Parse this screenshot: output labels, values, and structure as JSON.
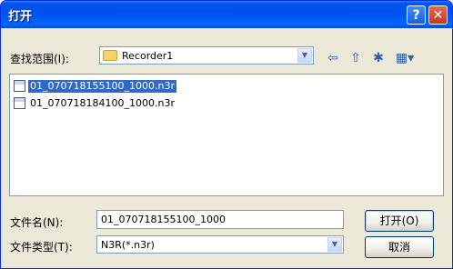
{
  "window": {
    "title": "打开"
  },
  "titlebar": {
    "help": "?",
    "close": "✕"
  },
  "lookin": {
    "label": "查找范围(I):",
    "value": "Recorder1"
  },
  "files": [
    {
      "name": "01_070718155100_1000.n3r",
      "selected": true
    },
    {
      "name": "01_070718184100_1000.n3r",
      "selected": false
    }
  ],
  "filename": {
    "label": "文件名(N):",
    "value": "01_070718155100_1000"
  },
  "filetype": {
    "label": "文件类型(T):",
    "value": "N3R(*.n3r)"
  },
  "buttons": {
    "open": "打开(O)",
    "cancel": "取消"
  },
  "icons": [
    "back-arrow-icon",
    "up-folder-icon",
    "new-folder-icon",
    "view-menu-icon"
  ]
}
